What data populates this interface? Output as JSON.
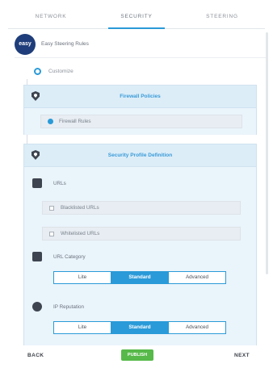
{
  "tabs": [
    {
      "label": "NETWORK"
    },
    {
      "label": "SECURITY"
    },
    {
      "label": "STEERING"
    }
  ],
  "rule": {
    "logo_text": "easy",
    "name": "Easy Steering Rules"
  },
  "customize": {
    "label": "Customize"
  },
  "firewall_section": {
    "title": "Firewall Policies",
    "item": "Firewall Rules"
  },
  "security_section": {
    "title": "Security Profile Definition",
    "urls_label": "URLs",
    "blacklisted": "Blacklisted URLs",
    "whitelisted": "Whitelisted URLs",
    "url_category_label": "URL Category",
    "ip_reputation_label": "IP Reputation"
  },
  "url_category_options": [
    "Lite",
    "Standard",
    "Advanced"
  ],
  "url_category_selected": "Standard",
  "ip_reputation_options": [
    "Lite",
    "Standard",
    "Advanced"
  ],
  "ip_reputation_selected": "Standard",
  "footer": {
    "back": "BACK",
    "publish": "PUBLISH",
    "next": "NEXT"
  },
  "colors": {
    "accent": "#2a9ad8",
    "publish": "#56b949",
    "logo": "#1e3d7a"
  },
  "icons": {
    "firewall": "shield-icon",
    "security": "shield-icon",
    "urls": "url-filter-icon",
    "category": "category-icon",
    "reputation": "shield-icon"
  }
}
